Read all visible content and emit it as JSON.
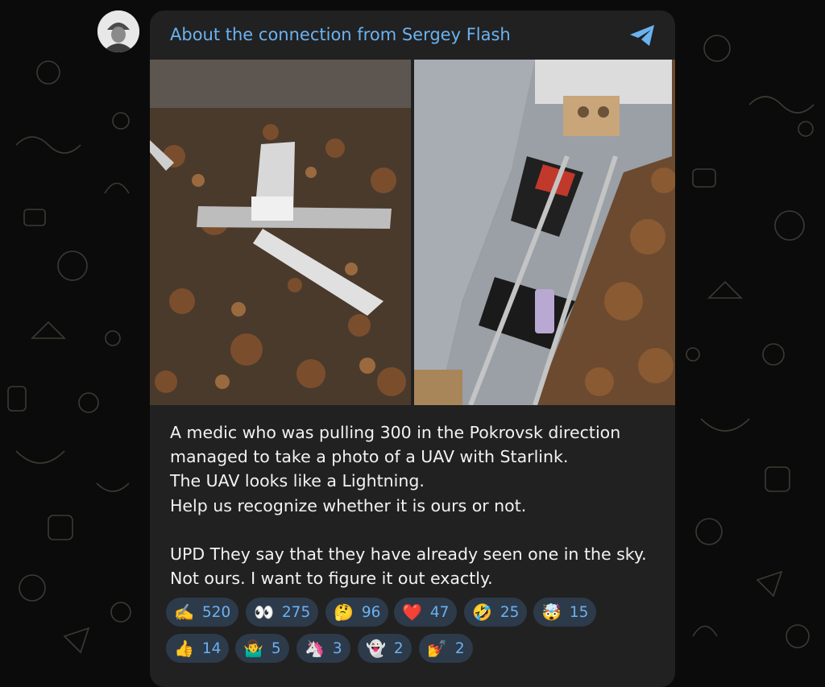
{
  "post": {
    "title": "About the connection from Sergey Flash",
    "text": "A medic who was pulling 300 in the Pokrovsk direction\nmanaged to take a photo of a UAV with Starlink.\nThe UAV looks like a Lightning.\nHelp us recognize whether it is ours or not.\n\nUPD They say that they have already seen one in the sky.\nNot ours. I want to figure it out exactly.",
    "images": [
      "crashed-uav-in-leaves-photo",
      "uav-interior-with-battery-photo"
    ]
  },
  "colors": {
    "accent": "#6ab2f2",
    "bubble": "#212121",
    "reaction_bg": "#2d3a4a",
    "background": "#0b0b0b"
  },
  "icons": [
    "avatar",
    "paper-plane-icon"
  ],
  "reactions": [
    {
      "emoji": "✍️",
      "count": "520"
    },
    {
      "emoji": "👀",
      "count": "275"
    },
    {
      "emoji": "🤔",
      "count": "96"
    },
    {
      "emoji": "❤️",
      "count": "47"
    },
    {
      "emoji": "🤣",
      "count": "25"
    },
    {
      "emoji": "🤯",
      "count": "15"
    },
    {
      "emoji": "👍",
      "count": "14"
    },
    {
      "emoji": "🤷‍♂️",
      "count": "5"
    },
    {
      "emoji": "🦄",
      "count": "3"
    },
    {
      "emoji": "👻",
      "count": "2"
    },
    {
      "emoji": "💅",
      "count": "2"
    }
  ]
}
